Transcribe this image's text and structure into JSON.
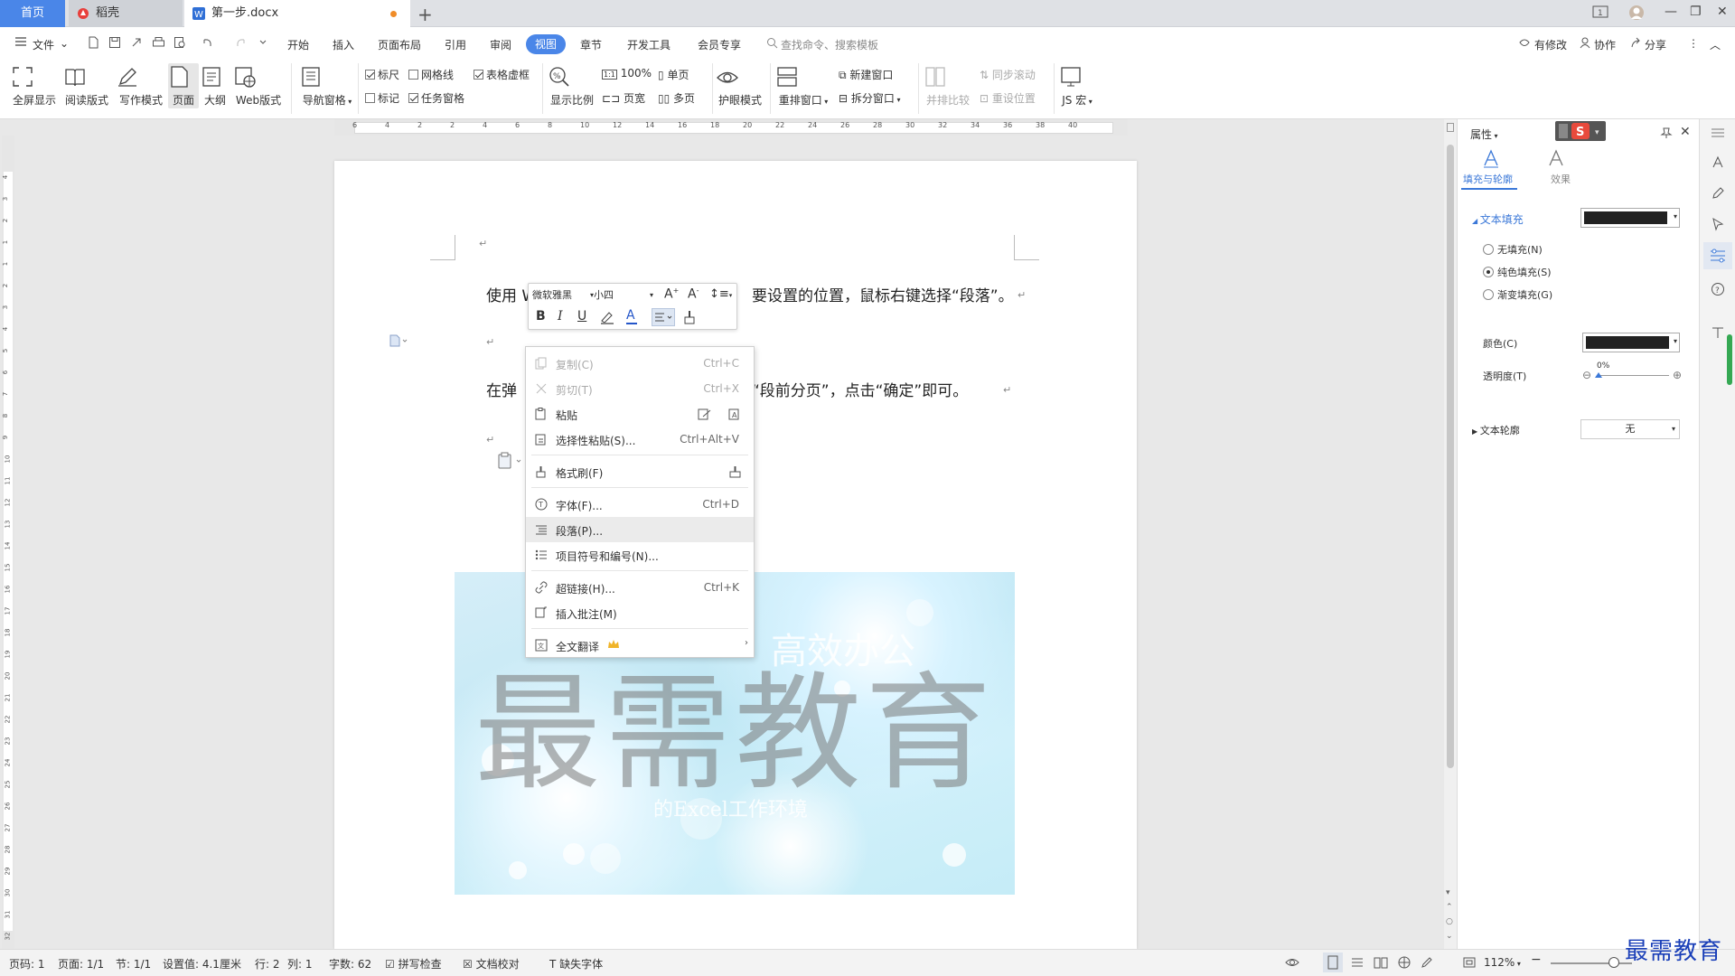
{
  "tabs": {
    "home": "首页",
    "straw": "稻壳",
    "doc": "第一步.docx"
  },
  "menu": {
    "file": "文件",
    "items": [
      "开始",
      "插入",
      "页面布局",
      "引用",
      "审阅",
      "视图",
      "章节",
      "开发工具",
      "会员专享"
    ],
    "active": "视图",
    "search_placeholder": "查找命令、搜索模板",
    "right": {
      "modify": "有修改",
      "collab": "协作",
      "share": "分享"
    }
  },
  "ribbon": {
    "fullscreen": "全屏显示",
    "read": "阅读版式",
    "write": "写作模式",
    "page": "页面",
    "outline": "大纲",
    "web": "Web版式",
    "nav": "导航窗格",
    "ruler": "标尺",
    "grid": "网格线",
    "tableframe": "表格虚框",
    "mark": "标记",
    "taskpane": "任务窗格",
    "zoom": "显示比例",
    "hundred": "100%",
    "single": "单页",
    "pagewidth": "页宽",
    "multi": "多页",
    "eye": "护眼模式",
    "rearrange": "重排窗口",
    "newwin": "新建窗口",
    "split": "拆分窗口",
    "compare": "并排比较",
    "syncscroll": "同步滚动",
    "resetpos": "重设位置",
    "macro": "JS 宏"
  },
  "doc": {
    "line1_a": "使用 W",
    "line1_b": "要设置的位置，鼠标右键选择“段落”。",
    "line2_a": "在弹",
    "line2_b": "“段前分页”，点击“确定”即可。",
    "ret": "↵"
  },
  "watermark": {
    "big": "最需教育",
    "s1": "高效办公",
    "s2": "的Excel工作环境"
  },
  "minibar": {
    "font": "微软雅黑",
    "size": "小四"
  },
  "context_menu": {
    "copy": "复制(C)",
    "copy_sc": "Ctrl+C",
    "cut": "剪切(T)",
    "cut_sc": "Ctrl+X",
    "paste": "粘贴",
    "pastespecial": "选择性粘贴(S)...",
    "pastespecial_sc": "Ctrl+Alt+V",
    "formatpainter": "格式刷(F)",
    "font": "字体(F)...",
    "font_sc": "Ctrl+D",
    "paragraph": "段落(P)...",
    "bullets": "项目符号和编号(N)...",
    "hyperlink": "超链接(H)...",
    "hyperlink_sc": "Ctrl+K",
    "comment": "插入批注(M)",
    "translate": "全文翻译"
  },
  "panel": {
    "title": "属性",
    "fill_tab": "填充与轮廓",
    "effect_tab": "效果",
    "text_fill": "文本填充",
    "none_fill": "无填充(N)",
    "solid_fill": "纯色填充(S)",
    "grad_fill": "渐变填充(G)",
    "color": "颜色(C)",
    "transparency": "透明度(T)",
    "transparency_val": "0%",
    "outline": "文本轮廓",
    "outline_val": "无",
    "fill_color": "#222222"
  },
  "status": {
    "pageno": "页码: 1",
    "pages": "页面: 1/1",
    "section": "节: 1/1",
    "setting": "设置值: 4.1厘米",
    "row": "行: 2",
    "col": "列: 1",
    "words": "字数: 62",
    "spell": "拼写检查",
    "proof": "文档校对",
    "missingfont": "缺失字体",
    "zoom": "112%"
  },
  "logo": "最需教育"
}
